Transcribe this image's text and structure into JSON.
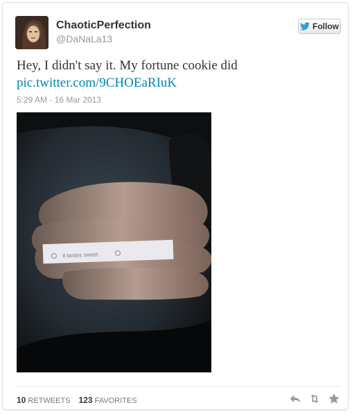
{
  "tweet": {
    "display_name": "ChaoticPerfection",
    "handle": "@DaNaLa13",
    "follow_label": "Follow",
    "text": "Hey, I didn't say it. My fortune cookie did",
    "link": "pic.twitter.com/9CHOEaRIuK",
    "timestamp": "5:29 AM - 16 Mar 2013"
  },
  "photo": {
    "fortune_text": "It tastes sweet."
  },
  "stats": {
    "retweets_count": "10",
    "retweets_label": "RETWEETS",
    "favorites_count": "123",
    "favorites_label": "FAVORITES"
  },
  "icons": {
    "follow": "twitter-bird-icon",
    "reply": "reply-icon",
    "retweet": "retweet-icon",
    "favorite": "star-icon"
  },
  "colors": {
    "link": "#0084b4",
    "bird": "#2ca0e0",
    "action_icons": "#999999"
  }
}
